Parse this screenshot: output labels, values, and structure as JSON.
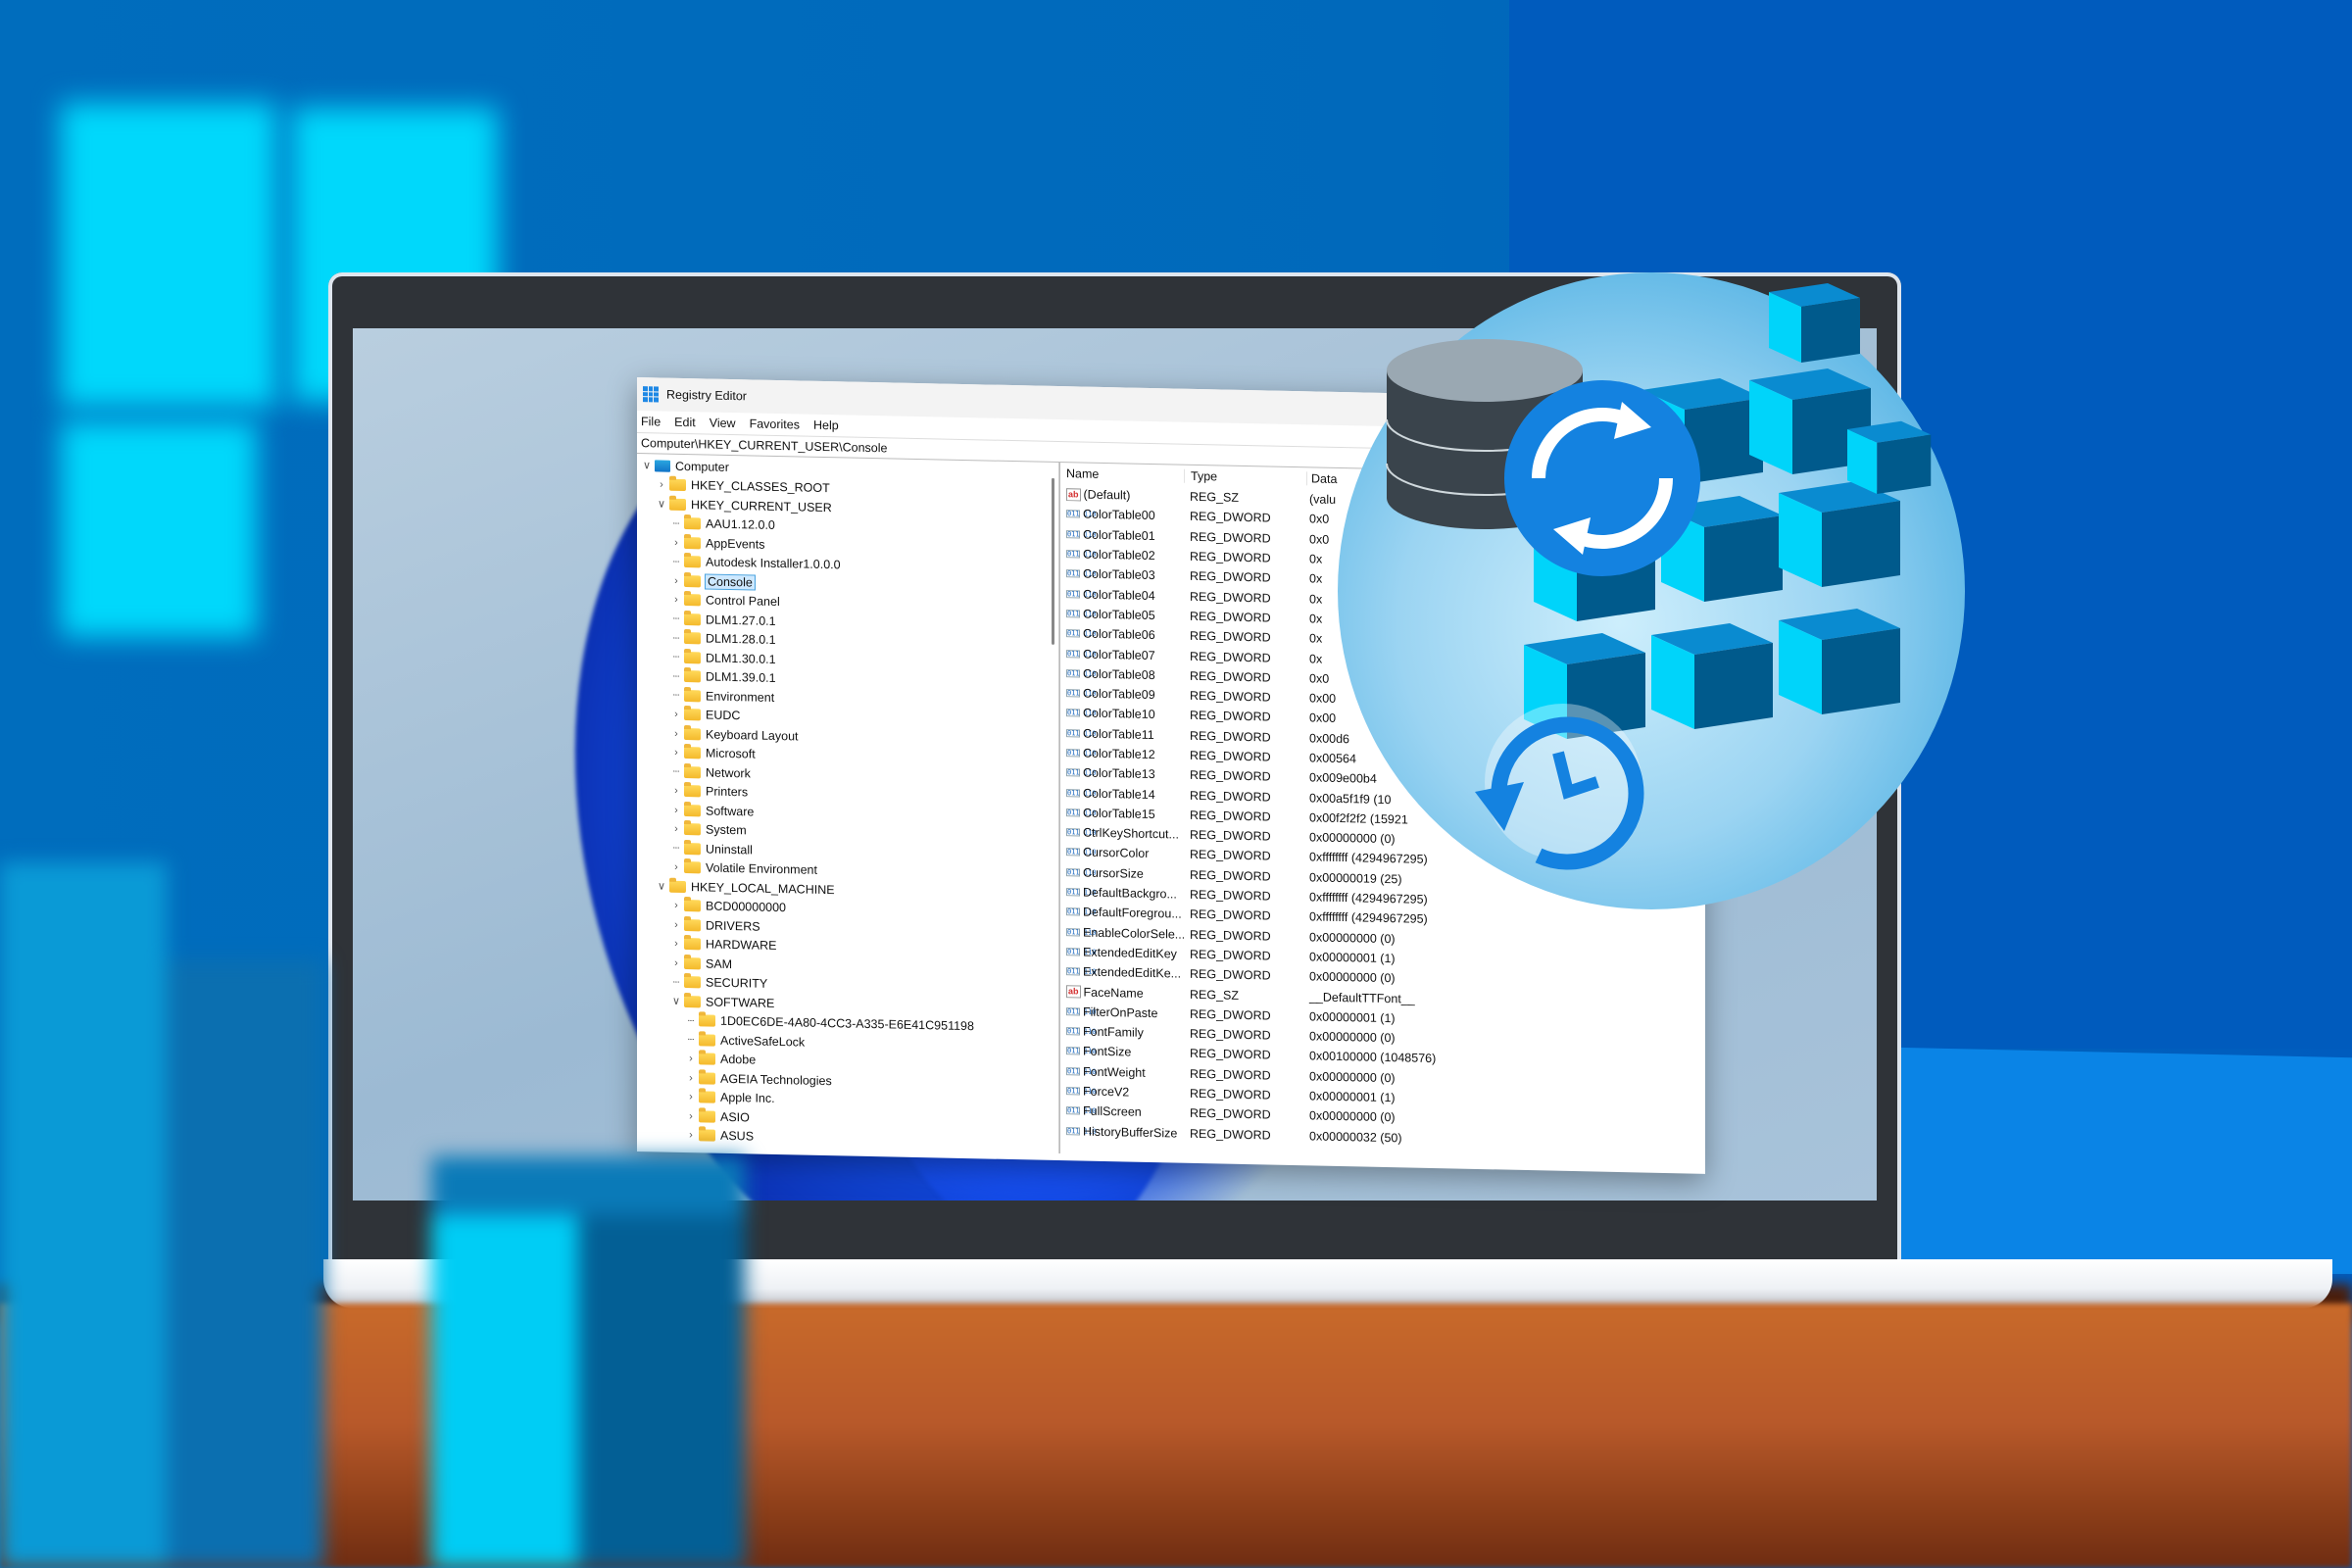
{
  "window": {
    "title": "Registry Editor",
    "menu": [
      "File",
      "Edit",
      "View",
      "Favorites",
      "Help"
    ],
    "address": "Computer\\HKEY_CURRENT_USER\\Console"
  },
  "tree": [
    {
      "label": "Computer",
      "level": 0,
      "expander": "open",
      "icon": "computer-icon"
    },
    {
      "label": "HKEY_CLASSES_ROOT",
      "level": 1,
      "expander": "closed",
      "icon": "folder-icon"
    },
    {
      "label": "HKEY_CURRENT_USER",
      "level": 1,
      "expander": "open",
      "icon": "folder-icon"
    },
    {
      "label": "AAU1.12.0.0",
      "level": 2,
      "expander": "none",
      "icon": "folder-icon"
    },
    {
      "label": "AppEvents",
      "level": 2,
      "expander": "closed",
      "icon": "folder-icon"
    },
    {
      "label": "Autodesk Installer1.0.0.0",
      "level": 2,
      "expander": "none",
      "icon": "folder-icon"
    },
    {
      "label": "Console",
      "level": 2,
      "expander": "closed",
      "icon": "folder-icon",
      "selected": true
    },
    {
      "label": "Control Panel",
      "level": 2,
      "expander": "closed",
      "icon": "folder-icon"
    },
    {
      "label": "DLM1.27.0.1",
      "level": 2,
      "expander": "none",
      "icon": "folder-icon"
    },
    {
      "label": "DLM1.28.0.1",
      "level": 2,
      "expander": "none",
      "icon": "folder-icon"
    },
    {
      "label": "DLM1.30.0.1",
      "level": 2,
      "expander": "none",
      "icon": "folder-icon"
    },
    {
      "label": "DLM1.39.0.1",
      "level": 2,
      "expander": "none",
      "icon": "folder-icon"
    },
    {
      "label": "Environment",
      "level": 2,
      "expander": "none",
      "icon": "folder-icon"
    },
    {
      "label": "EUDC",
      "level": 2,
      "expander": "closed",
      "icon": "folder-icon"
    },
    {
      "label": "Keyboard Layout",
      "level": 2,
      "expander": "closed",
      "icon": "folder-icon"
    },
    {
      "label": "Microsoft",
      "level": 2,
      "expander": "closed",
      "icon": "folder-icon"
    },
    {
      "label": "Network",
      "level": 2,
      "expander": "none",
      "icon": "folder-icon"
    },
    {
      "label": "Printers",
      "level": 2,
      "expander": "closed",
      "icon": "folder-icon"
    },
    {
      "label": "Software",
      "level": 2,
      "expander": "closed",
      "icon": "folder-icon"
    },
    {
      "label": "System",
      "level": 2,
      "expander": "closed",
      "icon": "folder-icon"
    },
    {
      "label": "Uninstall",
      "level": 2,
      "expander": "none",
      "icon": "folder-icon"
    },
    {
      "label": "Volatile Environment",
      "level": 2,
      "expander": "closed",
      "icon": "folder-icon"
    },
    {
      "label": "HKEY_LOCAL_MACHINE",
      "level": 1,
      "expander": "open",
      "icon": "folder-icon"
    },
    {
      "label": "BCD00000000",
      "level": 2,
      "expander": "closed",
      "icon": "folder-icon"
    },
    {
      "label": "DRIVERS",
      "level": 2,
      "expander": "closed",
      "icon": "folder-icon"
    },
    {
      "label": "HARDWARE",
      "level": 2,
      "expander": "closed",
      "icon": "folder-icon"
    },
    {
      "label": "SAM",
      "level": 2,
      "expander": "closed",
      "icon": "folder-icon"
    },
    {
      "label": "SECURITY",
      "level": 2,
      "expander": "none",
      "icon": "folder-icon"
    },
    {
      "label": "SOFTWARE",
      "level": 2,
      "expander": "open",
      "icon": "folder-icon"
    },
    {
      "label": "1D0EC6DE-4A80-4CC3-A335-E6E41C951198",
      "level": 3,
      "expander": "none",
      "icon": "folder-icon"
    },
    {
      "label": "ActiveSafeLock",
      "level": 3,
      "expander": "none",
      "icon": "folder-icon"
    },
    {
      "label": "Adobe",
      "level": 3,
      "expander": "closed",
      "icon": "folder-icon"
    },
    {
      "label": "AGEIA Technologies",
      "level": 3,
      "expander": "closed",
      "icon": "folder-icon"
    },
    {
      "label": "Apple Inc.",
      "level": 3,
      "expander": "closed",
      "icon": "folder-icon"
    },
    {
      "label": "ASIO",
      "level": 3,
      "expander": "closed",
      "icon": "folder-icon"
    },
    {
      "label": "ASUS",
      "level": 3,
      "expander": "closed",
      "icon": "folder-icon"
    }
  ],
  "values": {
    "columns": [
      "Name",
      "Type",
      "Data"
    ],
    "rows": [
      {
        "name": "(Default)",
        "type": "REG_SZ",
        "data": "(valu",
        "kind": "sz"
      },
      {
        "name": "ColorTable00",
        "type": "REG_DWORD",
        "data": "0x0",
        "kind": "bin"
      },
      {
        "name": "ColorTable01",
        "type": "REG_DWORD",
        "data": "0x0",
        "kind": "bin"
      },
      {
        "name": "ColorTable02",
        "type": "REG_DWORD",
        "data": "0x",
        "kind": "bin"
      },
      {
        "name": "ColorTable03",
        "type": "REG_DWORD",
        "data": "0x",
        "kind": "bin"
      },
      {
        "name": "ColorTable04",
        "type": "REG_DWORD",
        "data": "0x",
        "kind": "bin"
      },
      {
        "name": "ColorTable05",
        "type": "REG_DWORD",
        "data": "0x",
        "kind": "bin"
      },
      {
        "name": "ColorTable06",
        "type": "REG_DWORD",
        "data": "0x",
        "kind": "bin"
      },
      {
        "name": "ColorTable07",
        "type": "REG_DWORD",
        "data": "0x",
        "kind": "bin"
      },
      {
        "name": "ColorTable08",
        "type": "REG_DWORD",
        "data": "0x0",
        "kind": "bin"
      },
      {
        "name": "ColorTable09",
        "type": "REG_DWORD",
        "data": "0x00",
        "kind": "bin"
      },
      {
        "name": "ColorTable10",
        "type": "REG_DWORD",
        "data": "0x00",
        "kind": "bin"
      },
      {
        "name": "ColorTable11",
        "type": "REG_DWORD",
        "data": "0x00d6",
        "kind": "bin"
      },
      {
        "name": "ColorTable12",
        "type": "REG_DWORD",
        "data": "0x00564",
        "kind": "bin"
      },
      {
        "name": "ColorTable13",
        "type": "REG_DWORD",
        "data": "0x009e00b4",
        "kind": "bin"
      },
      {
        "name": "ColorTable14",
        "type": "REG_DWORD",
        "data": "0x00a5f1f9 (10",
        "kind": "bin"
      },
      {
        "name": "ColorTable15",
        "type": "REG_DWORD",
        "data": "0x00f2f2f2 (15921",
        "kind": "bin"
      },
      {
        "name": "CtrlKeyShortcut...",
        "type": "REG_DWORD",
        "data": "0x00000000 (0)",
        "kind": "bin"
      },
      {
        "name": "CursorColor",
        "type": "REG_DWORD",
        "data": "0xffffffff (4294967295)",
        "kind": "bin"
      },
      {
        "name": "CursorSize",
        "type": "REG_DWORD",
        "data": "0x00000019 (25)",
        "kind": "bin"
      },
      {
        "name": "DefaultBackgro...",
        "type": "REG_DWORD",
        "data": "0xffffffff (4294967295)",
        "kind": "bin"
      },
      {
        "name": "DefaultForegrou...",
        "type": "REG_DWORD",
        "data": "0xffffffff (4294967295)",
        "kind": "bin"
      },
      {
        "name": "EnableColorSele...",
        "type": "REG_DWORD",
        "data": "0x00000000 (0)",
        "kind": "bin"
      },
      {
        "name": "ExtendedEditKey",
        "type": "REG_DWORD",
        "data": "0x00000001 (1)",
        "kind": "bin"
      },
      {
        "name": "ExtendedEditKe...",
        "type": "REG_DWORD",
        "data": "0x00000000 (0)",
        "kind": "bin"
      },
      {
        "name": "FaceName",
        "type": "REG_SZ",
        "data": "__DefaultTTFont__",
        "kind": "sz"
      },
      {
        "name": "FilterOnPaste",
        "type": "REG_DWORD",
        "data": "0x00000001 (1)",
        "kind": "bin"
      },
      {
        "name": "FontFamily",
        "type": "REG_DWORD",
        "data": "0x00000000 (0)",
        "kind": "bin"
      },
      {
        "name": "FontSize",
        "type": "REG_DWORD",
        "data": "0x00100000 (1048576)",
        "kind": "bin"
      },
      {
        "name": "FontWeight",
        "type": "REG_DWORD",
        "data": "0x00000000 (0)",
        "kind": "bin"
      },
      {
        "name": "ForceV2",
        "type": "REG_DWORD",
        "data": "0x00000001 (1)",
        "kind": "bin"
      },
      {
        "name": "FullScreen",
        "type": "REG_DWORD",
        "data": "0x00000000 (0)",
        "kind": "bin"
      },
      {
        "name": "HistoryBufferSize",
        "type": "REG_DWORD",
        "data": "0x00000032 (50)",
        "kind": "bin"
      }
    ]
  },
  "overlay": {
    "icons": [
      "database-icon",
      "sync-icon",
      "registry-cubes-icon",
      "restore-history-icon"
    ]
  },
  "colors": {
    "background": "#0066b8",
    "cube_light": "#00d4fa",
    "cube_dark": "#005a8c",
    "accent": "#1e88e5"
  }
}
